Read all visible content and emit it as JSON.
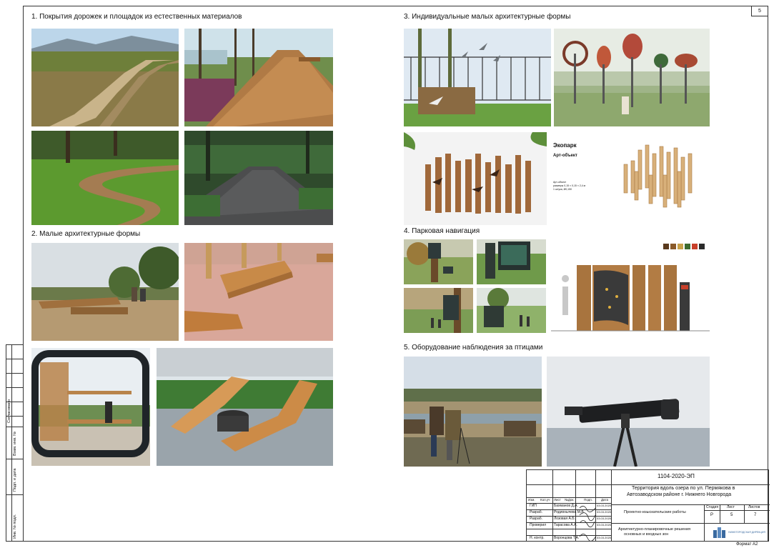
{
  "sheet_number": "5",
  "format_label": "Формат А2",
  "sections": {
    "s1": "1. Покрытия дорожек и площадок из естественных материалов",
    "s2": "2. Малые архитектурные формы",
    "s3": "3. Индивидуальные малых архитектурные формы",
    "s4": "4. Парковая навигация",
    "s5": "5. Оборудование наблюдения за птицами"
  },
  "ecopark": {
    "title": "Экопарк",
    "subtitle": "Арт-объект",
    "note_line1": "Арт-объект",
    "note_line2": "размеры 0,15 × 0,15 × 2,4 м",
    "note_line3": "1 штука, Ø0,150"
  },
  "palette": {
    "swatches": [
      "#5a3a1e",
      "#8a5a2a",
      "#c9a24a",
      "#3e6b2f",
      "#c8402a",
      "#2b2b2b"
    ],
    "sky": "#cfe0ee",
    "grass": "#5f9a3a",
    "wood": "#b98a52",
    "dark": "#2e3330"
  },
  "margin_stamp": {
    "agreed": "Согласовано",
    "inv_replace": "Взам. инв. №",
    "sign_date": "Подп. и дата",
    "inv_orig": "Инв. № подл."
  },
  "title_block": {
    "code": "1104-2020-ЭП",
    "project_line1": "Территория вдоль озера по ул. Пермякова в",
    "project_line2": "Автозаводском районе г. Нижнего Новгорода",
    "stage_name": "Проектно-изыскательские работы",
    "sheet_title_line1": "Архитектурно-планировочные решения",
    "sheet_title_line2": "основных и входных зон",
    "headers": [
      "Изм.",
      "Кол.уч",
      "Лист",
      "№Док.",
      "Подп.",
      "Дата"
    ],
    "stage_headers": [
      "Стадия",
      "Лист",
      "Листов"
    ],
    "stage_values": [
      "Р",
      "5",
      "7"
    ],
    "roles": [
      {
        "role": "ГИП",
        "name": "Бахманов Д.А.",
        "date": "03.03.2020"
      },
      {
        "role": "Разраб.",
        "name": "Родионычева М.В.",
        "date": "03.03.2020"
      },
      {
        "role": "Разраб.",
        "name": "Лозовая А.Б.",
        "date": "03.03.2020"
      },
      {
        "role": "Проверил",
        "name": "Тарасова А.А.",
        "date": "03.03.2020"
      },
      {
        "role": "",
        "name": "",
        "date": ""
      },
      {
        "role": "Н. контр.",
        "name": "Воронцова Т.А.",
        "date": "03.03.2020"
      }
    ],
    "org_name": "НИЖЕГОРОДСКАЯ ДИРЕКЦИЯ"
  }
}
